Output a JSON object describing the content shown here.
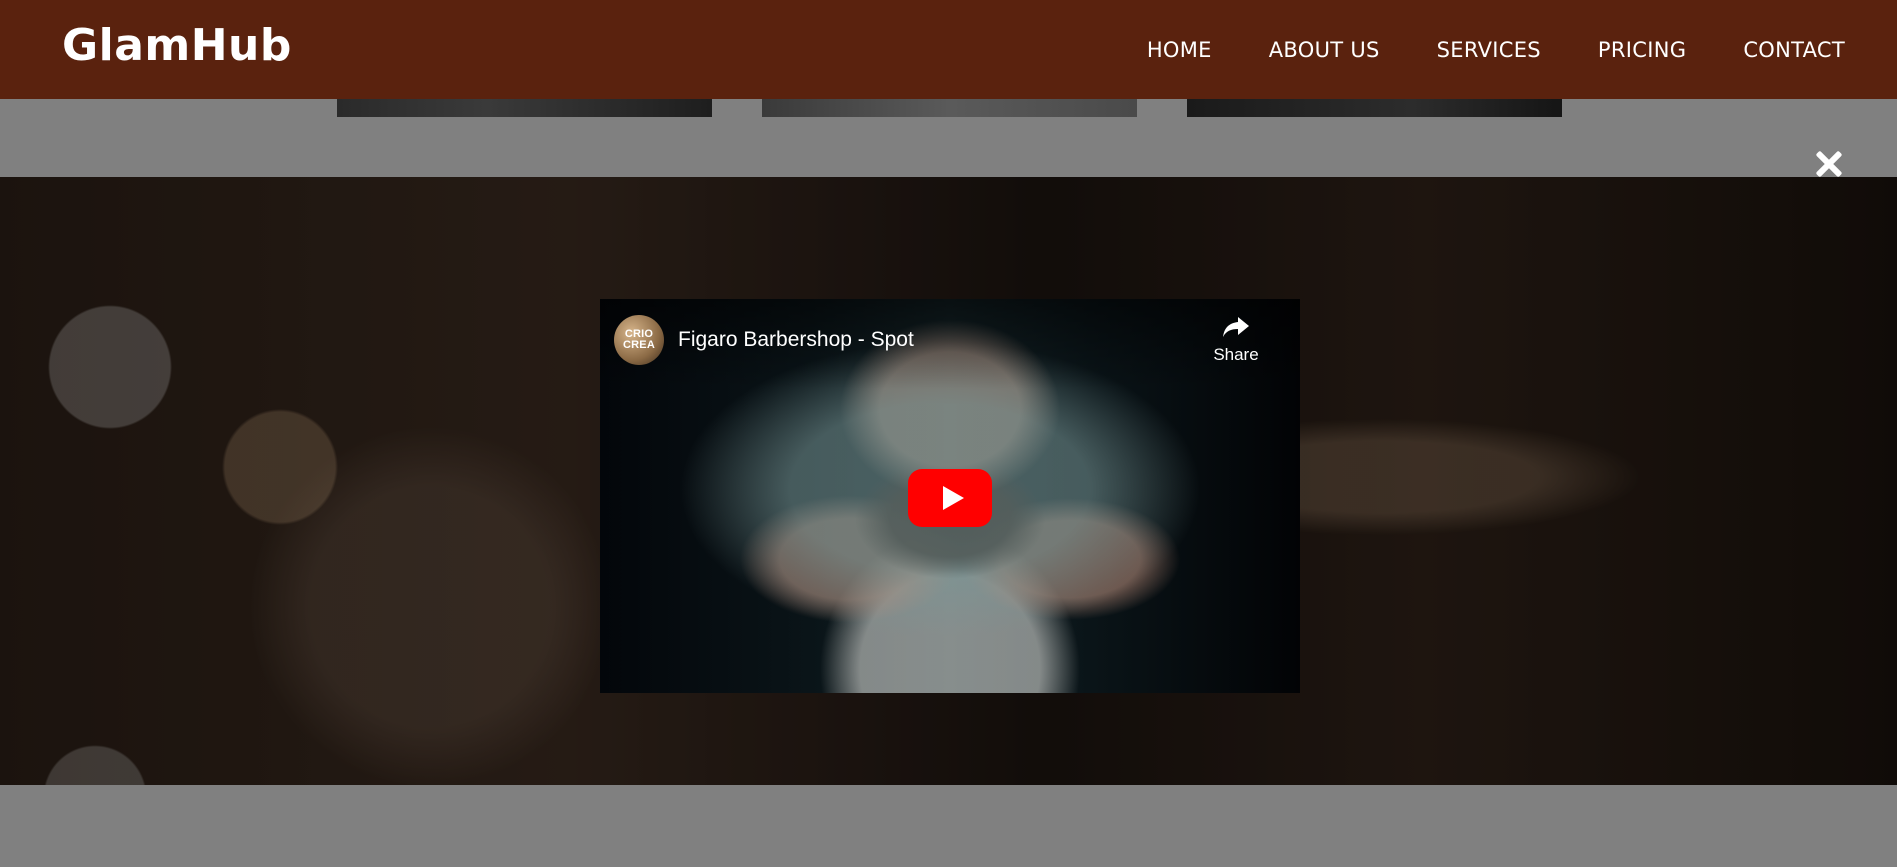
{
  "header": {
    "logo": "GlamHub",
    "nav": [
      "HOME",
      "ABOUT US",
      "SERVICES",
      "PRICING",
      "CONTACT"
    ]
  },
  "video": {
    "channel_avatar_text": [
      "CRIO",
      "CREA"
    ],
    "title": "Figaro Barbershop - Spot",
    "share_label": "Share",
    "play_icon": "play-icon"
  },
  "modal": {
    "close_icon": "close-icon"
  },
  "colors": {
    "header_bg": "#5a220e",
    "overlay": "#808080",
    "play_button": "#ff0000"
  }
}
